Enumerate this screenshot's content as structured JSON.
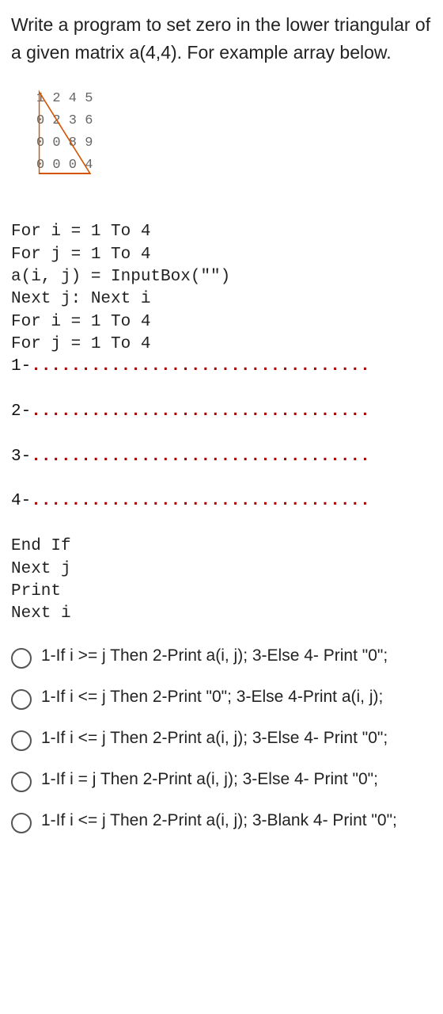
{
  "question": "Write a program to set zero in the lower triangular of a given matrix a(4,4). For example array below.",
  "matrix": [
    "1 2 4 5",
    "0 2 3 6",
    "0 0 8 9",
    "0 0 0 4"
  ],
  "code": {
    "l1": "For i = 1 To 4",
    "l2": "For j = 1 To 4",
    "l3": "a(i, j) = InputBox(\"\")",
    "l4": "Next j: Next i",
    "l5": "For i = 1 To 4",
    "l6": "For j = 1 To 4",
    "b1": "1-",
    "b2": "2-",
    "b3": "3-",
    "b4": "4-",
    "dots": "..................................",
    "l7": "End If",
    "l8": "Next j",
    "l9": "Print",
    "l10": "Next i"
  },
  "options": [
    "1-If i >= j Then 2-Print a(i, j); 3-Else 4- Print \"0\";",
    "1-If i <= j Then 2-Print \"0\"; 3-Else 4-Print a(i, j);",
    "1-If i <= j Then 2-Print a(i, j); 3-Else 4- Print \"0\";",
    "1-If i = j Then 2-Print a(i, j); 3-Else 4- Print \"0\";",
    "1-If i <= j Then 2-Print a(i, j); 3-Blank 4- Print \"0\";"
  ]
}
